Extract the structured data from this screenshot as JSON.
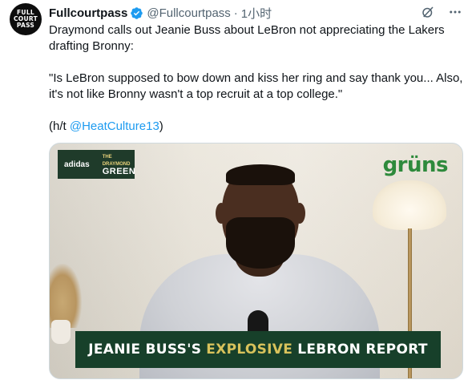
{
  "tweet": {
    "avatar_lines": [
      "FULL",
      "COURT",
      "PASS"
    ],
    "display_name": "Fullcourtpass",
    "handle": "@Fullcourtpass",
    "separator": "·",
    "time": "1小时",
    "verified": true,
    "icons": [
      "verified-badge-icon",
      "grok-icon",
      "more-icon"
    ],
    "text_line1": "Draymond calls out Jeanie Buss about LeBron not appreciating the Lakers drafting Bronny:",
    "quote": "\"Is LeBron supposed to bow down and kiss her ring and say thank you... Also, it's not like Bronny wasn't a top recruit at a top college.\"",
    "credit_prefix": "(h/t ",
    "credit_link": "@HeatCulture13",
    "credit_suffix": ")"
  },
  "media": {
    "show_logo_top": "THE DRAYMOND",
    "show_logo_main": "GREEN",
    "sponsor_left": "adidas",
    "sponsor": "grüns",
    "banner_part1": "JEANIE BUSS'S",
    "banner_part2": "EXPLOSIVE",
    "banner_part3": "LEBRON REPORT",
    "colors": {
      "banner_bg": "#17402a",
      "banner_highlight": "#d8c25b",
      "sponsor_green": "#2e8a3c",
      "link_blue": "#1d9bf0"
    }
  }
}
